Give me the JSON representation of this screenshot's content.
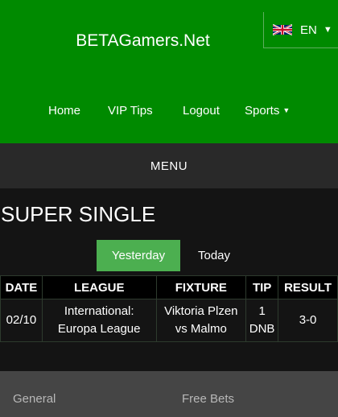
{
  "header": {
    "site_title": "BETAGamers.Net",
    "language": {
      "code": "EN",
      "flag": "uk-flag-icon"
    },
    "nav": [
      {
        "label": "Home"
      },
      {
        "label": "VIP Tips"
      },
      {
        "label": "Logout"
      },
      {
        "label": "Sports",
        "icon": "caret-down-icon"
      }
    ]
  },
  "menu": {
    "label": "MENU"
  },
  "section": {
    "title": "SUPER SINGLE",
    "tabs": [
      {
        "label": "Yesterday",
        "active": true
      },
      {
        "label": "Today",
        "active": false
      }
    ]
  },
  "table": {
    "columns": [
      "DATE",
      "LEAGUE",
      "FIXTURE",
      "TIP",
      "RESULT"
    ],
    "rows": [
      {
        "date": "02/10",
        "league": [
          "International:",
          "Europa League"
        ],
        "fixture": [
          "Viktoria Plzen",
          "vs Malmo"
        ],
        "tip": [
          "1",
          "DNB"
        ],
        "result": "3-0"
      }
    ]
  },
  "footer": {
    "links": [
      {
        "label": "General"
      },
      {
        "label": "Free Bets"
      }
    ]
  },
  "colors": {
    "header_green": "#008a00",
    "tab_active": "#4caf50",
    "menu_bar": "#292929",
    "page_bg": "#141414",
    "footer_bg": "#454545"
  }
}
